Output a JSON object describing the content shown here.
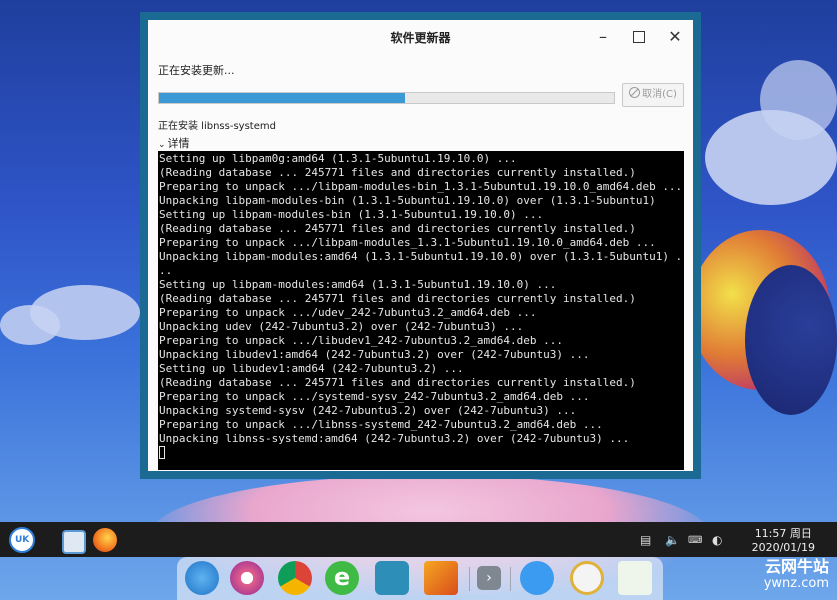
{
  "window": {
    "title": "软件更新器",
    "status": "正在安装更新...",
    "progress": 0.54,
    "cancel_label": "取消(C)",
    "package_status": "正在安装 libnss-systemd",
    "details_label": "详情"
  },
  "terminal": {
    "lines": [
      "Setting up libpam0g:amd64 (1.3.1-5ubuntu1.19.10.0) ...",
      "(Reading database ... 245771 files and directories currently installed.)",
      "Preparing to unpack .../libpam-modules-bin_1.3.1-5ubuntu1.19.10.0_amd64.deb ...",
      "Unpacking libpam-modules-bin (1.3.1-5ubuntu1.19.10.0) over (1.3.1-5ubuntu1)",
      "Setting up libpam-modules-bin (1.3.1-5ubuntu1.19.10.0) ...",
      "(Reading database ... 245771 files and directories currently installed.)",
      "Preparing to unpack .../libpam-modules_1.3.1-5ubuntu1.19.10.0_amd64.deb ...",
      "Unpacking libpam-modules:amd64 (1.3.1-5ubuntu1.19.10.0) over (1.3.1-5ubuntu1) .",
      "..",
      "Setting up libpam-modules:amd64 (1.3.1-5ubuntu1.19.10.0) ...",
      "(Reading database ... 245771 files and directories currently installed.)",
      "Preparing to unpack .../udev_242-7ubuntu3.2_amd64.deb ...",
      "Unpacking udev (242-7ubuntu3.2) over (242-7ubuntu3) ...",
      "Preparing to unpack .../libudev1_242-7ubuntu3.2_amd64.deb ...",
      "Unpacking libudev1:amd64 (242-7ubuntu3.2) over (242-7ubuntu3) ...",
      "Setting up libudev1:amd64 (242-7ubuntu3.2) ...",
      "(Reading database ... 245771 files and directories currently installed.)",
      "Preparing to unpack .../systemd-sysv_242-7ubuntu3.2_amd64.deb ...",
      "Unpacking systemd-sysv (242-7ubuntu3.2) over (242-7ubuntu3) ...",
      "Preparing to unpack .../libnss-systemd_242-7ubuntu3.2_amd64.deb ...",
      "Unpacking libnss-systemd:amd64 (242-7ubuntu3.2) over (242-7ubuntu3) ..."
    ]
  },
  "taskbar": {
    "time": "11:57 周日",
    "date": "2020/01/19",
    "start_text": "UK",
    "tray_icons": [
      "network-icon",
      "volume-icon",
      "keyboard-icon",
      "night-mode-icon"
    ]
  },
  "dock": {
    "items": [
      "deepin-icon",
      "settings-icon",
      "chrome-icon",
      "edge-icon",
      "monitor-icon",
      "terminal-64-icon",
      "more-icon",
      "power-icon",
      "clock-icon",
      "trash-icon"
    ]
  },
  "watermark": {
    "cn": "云网牛站",
    "en": "ywnz.com"
  },
  "colors": {
    "accent": "#3d98d6",
    "window_border": "#1b6a93",
    "terminal_bg": "#000000"
  }
}
